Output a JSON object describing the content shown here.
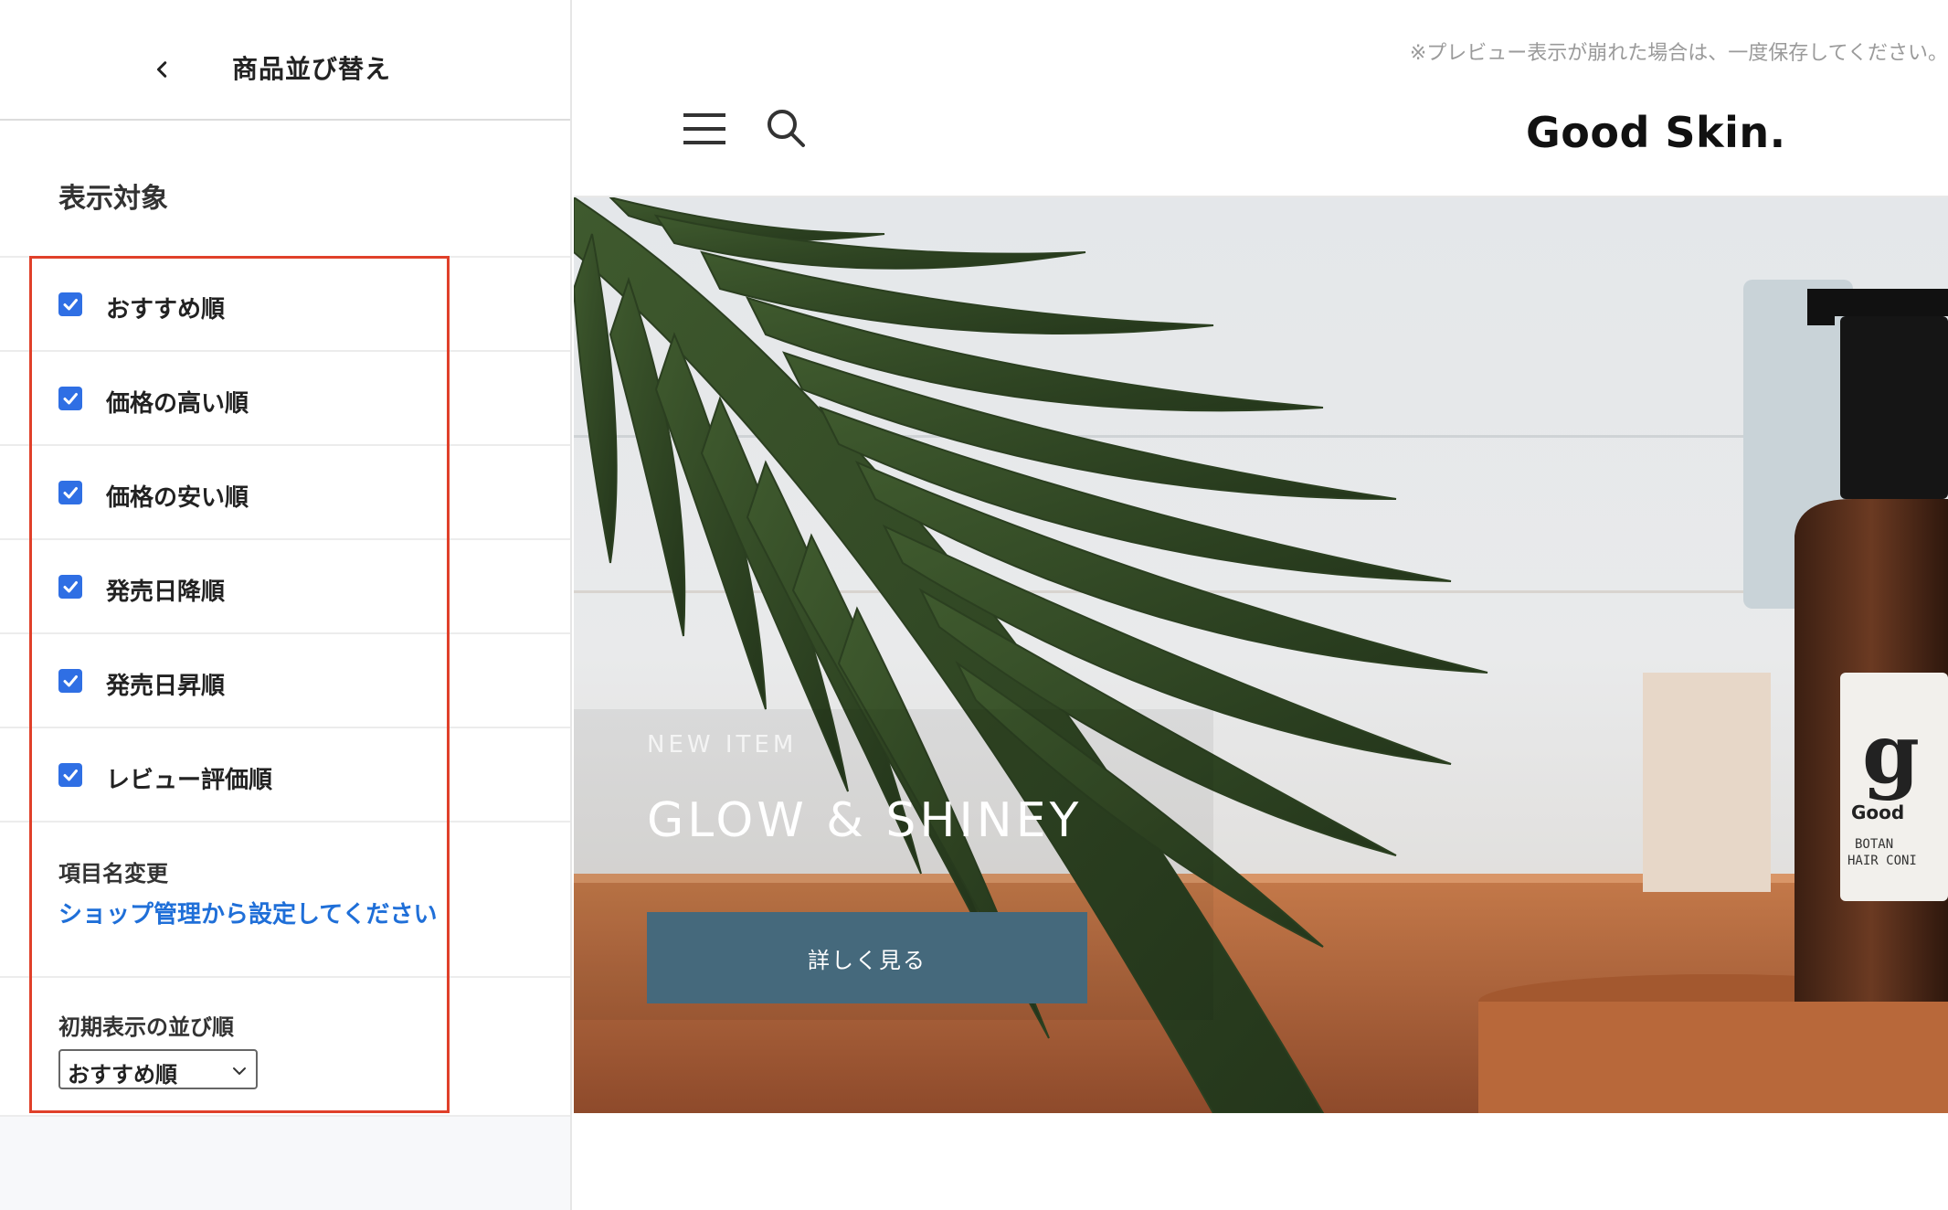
{
  "sidebar": {
    "header_title": "商品並び替え",
    "section_title": "表示対象",
    "options": [
      {
        "label": "おすすめ順",
        "checked": true
      },
      {
        "label": "価格の高い順",
        "checked": true
      },
      {
        "label": "価格の安い順",
        "checked": true
      },
      {
        "label": "発売日降順",
        "checked": true
      },
      {
        "label": "発売日昇順",
        "checked": true
      },
      {
        "label": "レビュー評価順",
        "checked": true
      }
    ],
    "rename_title": "項目名変更",
    "rename_link": "ショップ管理から設定してください",
    "default_order_title": "初期表示の並び順",
    "default_order_value": "おすすめ順"
  },
  "preview": {
    "note": "※プレビュー表示が崩れた場合は、一度保存してください。",
    "logo": "Good Skin.",
    "hero": {
      "kicker": "NEW ITEM",
      "title": "GLOW & SHINEY",
      "button_label": "詳しく見る",
      "bottle_label_letter": "g",
      "bottle_label_brand": "Good",
      "bottle_label_line1": "BOTAN",
      "bottle_label_line2": "HAIR CONI"
    }
  },
  "colors": {
    "accent": "#2f6fe4",
    "link": "#1f6fd8",
    "highlight": "#e0402a",
    "hero_button": "#45697c"
  }
}
